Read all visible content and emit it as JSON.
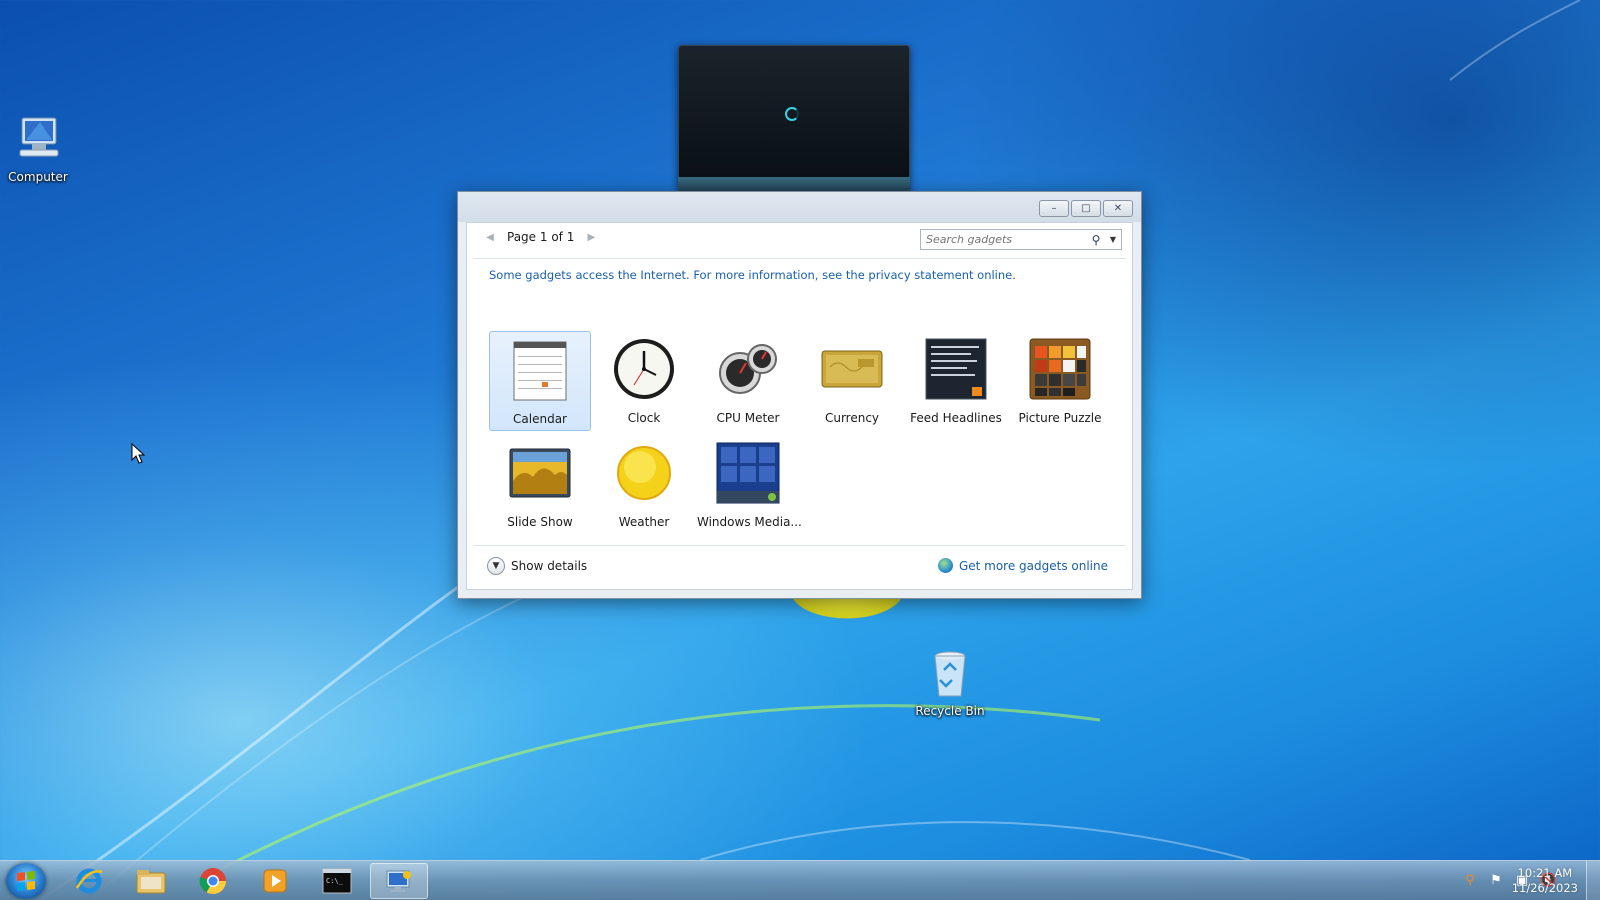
{
  "desktop": {
    "icons": [
      {
        "label": "Computer",
        "icon": "computer-icon"
      },
      {
        "label": "Recycle Bin",
        "icon": "recycle-bin-icon"
      }
    ]
  },
  "window": {
    "controls": {
      "minimize": "–",
      "maximize": "□",
      "close": "✕"
    },
    "pager": {
      "prev": "◀",
      "label": "Page 1 of 1",
      "next": "▶"
    },
    "search": {
      "placeholder": "Search gadgets",
      "value": ""
    },
    "notice": "Some gadgets access the Internet.  For more information, see the privacy statement online.",
    "gadgets": [
      {
        "label": "Calendar",
        "icon": "calendar-icon",
        "selected": true
      },
      {
        "label": "Clock",
        "icon": "clock-icon",
        "selected": false
      },
      {
        "label": "CPU Meter",
        "icon": "cpu-meter-icon",
        "selected": false
      },
      {
        "label": "Currency",
        "icon": "currency-icon",
        "selected": false
      },
      {
        "label": "Feed Headlines",
        "icon": "feed-headlines-icon",
        "selected": false
      },
      {
        "label": "Picture Puzzle",
        "icon": "picture-puzzle-icon",
        "selected": false
      },
      {
        "label": "Slide Show",
        "icon": "slide-show-icon",
        "selected": false
      },
      {
        "label": "Weather",
        "icon": "weather-icon",
        "selected": false
      },
      {
        "label": "Windows Media...",
        "icon": "windows-media-icon",
        "selected": false
      }
    ],
    "footer": {
      "show_details": "Show details",
      "get_more": "Get more gadgets online"
    }
  },
  "taskbar": {
    "apps": [
      {
        "name": "internet-explorer",
        "active": false
      },
      {
        "name": "file-explorer",
        "active": false
      },
      {
        "name": "chrome",
        "active": false
      },
      {
        "name": "media-player",
        "active": false
      },
      {
        "name": "command-prompt",
        "active": false
      },
      {
        "name": "desktop-gadgets",
        "active": true
      }
    ],
    "clock": {
      "time": "10:21 AM",
      "date": "11/26/2023"
    }
  },
  "colors": {
    "link": "#1a5fa8",
    "accent": "#2a7fd0"
  }
}
